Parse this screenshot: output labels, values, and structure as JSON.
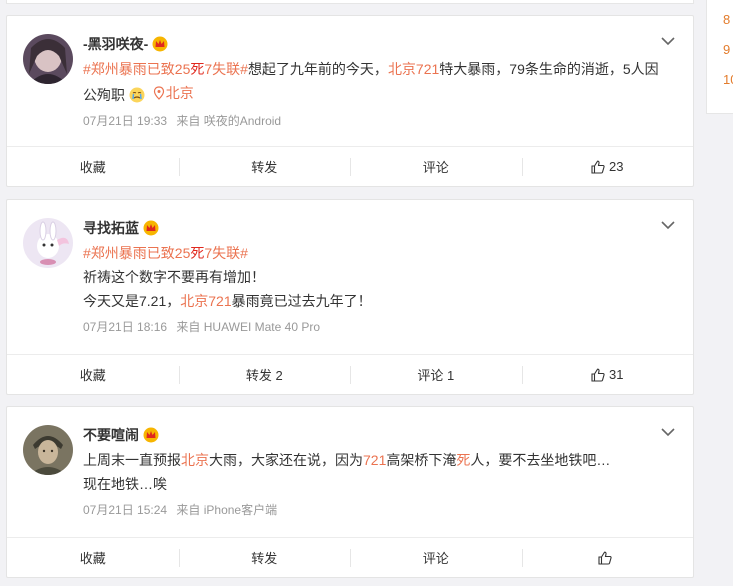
{
  "right_panel": {
    "numbers": [
      "8",
      "9",
      "10"
    ]
  },
  "posts": [
    {
      "name": "-黑羽咲夜-",
      "text_parts": {
        "tag": "#郑州暴雨已致25",
        "tag_red": "死",
        "tag_end": "7失联#",
        "t1": "想起了九年前的今天，",
        "hl1": "北京721",
        "t2": "特大暴雨，79条生命的消逝，5人因",
        "t3": "公殉职",
        "loc": "北京"
      },
      "time": "07月21日 19:33",
      "source": "来自 咲夜的Android",
      "actions": {
        "fav": "收藏",
        "repost": "转发",
        "comment": "评论",
        "like": "23"
      }
    },
    {
      "name": "寻找拓蓝",
      "text_parts": {
        "tag": "#郑州暴雨已致25",
        "tag_red": "死",
        "tag_end": "7失联#",
        "l2": "祈祷这个数字不要再有增加！",
        "l3a": "今天又是7.21，",
        "hl1": "北京721",
        "l3b": "暴雨竟已过去九年了！"
      },
      "time": "07月21日 18:16",
      "source": "来自 HUAWEI Mate 40 Pro",
      "actions": {
        "fav": "收藏",
        "repost": "转发 2",
        "comment": "评论 1",
        "like": "31"
      }
    },
    {
      "name": "不要喧闹",
      "text_parts": {
        "a": "上周末一直预报",
        "hl1": "北京",
        "b": "大雨，大家还在说，因为",
        "hl2": "721",
        "c": "高架桥下淹",
        "hl3": "死",
        "d": "人，要不去坐地铁吧…",
        "l2": "现在地铁…唉"
      },
      "time": "07月21日 15:24",
      "source": "来自 iPhone客户端",
      "actions": {
        "fav": "收藏",
        "repost": "转发",
        "comment": "评论",
        "like": ""
      }
    }
  ],
  "colors": {
    "accent": "#eb7350",
    "orange_num": "#e37c2c",
    "meta": "#999999"
  }
}
